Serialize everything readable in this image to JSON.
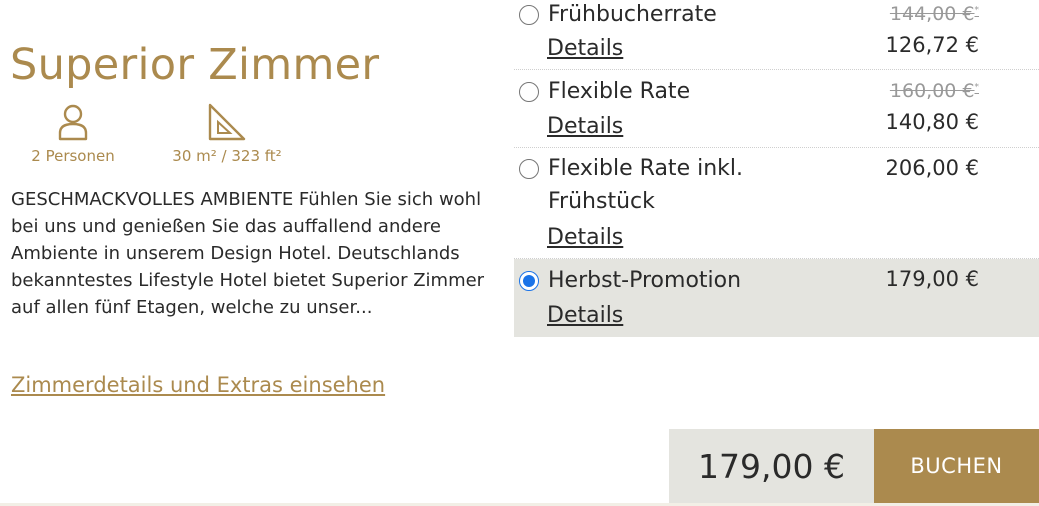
{
  "room": {
    "title": "Superior Zimmer",
    "persons_label": "2 Personen",
    "size_label": "30 m² / 323 ft²",
    "description": "GESCHMACKVOLLES AMBIENTE Fühlen Sie sich wohl bei uns und genießen Sie das auffallend andere Ambiente in unserem Design Hotel. Deutschlands bekanntestes Lifestyle Hotel bietet Superior Zimmer auf allen fünf Etagen, welche zu unser...",
    "details_link": "Zimmerdetails und Extras einsehen",
    "icons": [
      "person-icon",
      "ruler-triangle-icon"
    ]
  },
  "rates": [
    {
      "name": "Frühbucherrate",
      "details": "Details",
      "old_price": "144,00 €",
      "old_price_mark": "*",
      "price": "126,72 €",
      "selected": false
    },
    {
      "name": "Flexible Rate",
      "details": "Details",
      "old_price": "160,00 €",
      "old_price_mark": "*",
      "price": "140,80 €",
      "selected": false
    },
    {
      "name": "Flexible Rate inkl. Frühstück",
      "details": "Details",
      "price": "206,00 €",
      "selected": false
    },
    {
      "name": "Herbst-Promotion",
      "details": "Details",
      "price": "179,00 €",
      "selected": true
    }
  ],
  "footer": {
    "total": "179,00 €",
    "book_label": "BUCHEN"
  },
  "colors": {
    "accent": "#ab8a4e",
    "selected_bg": "#e4e4df"
  }
}
